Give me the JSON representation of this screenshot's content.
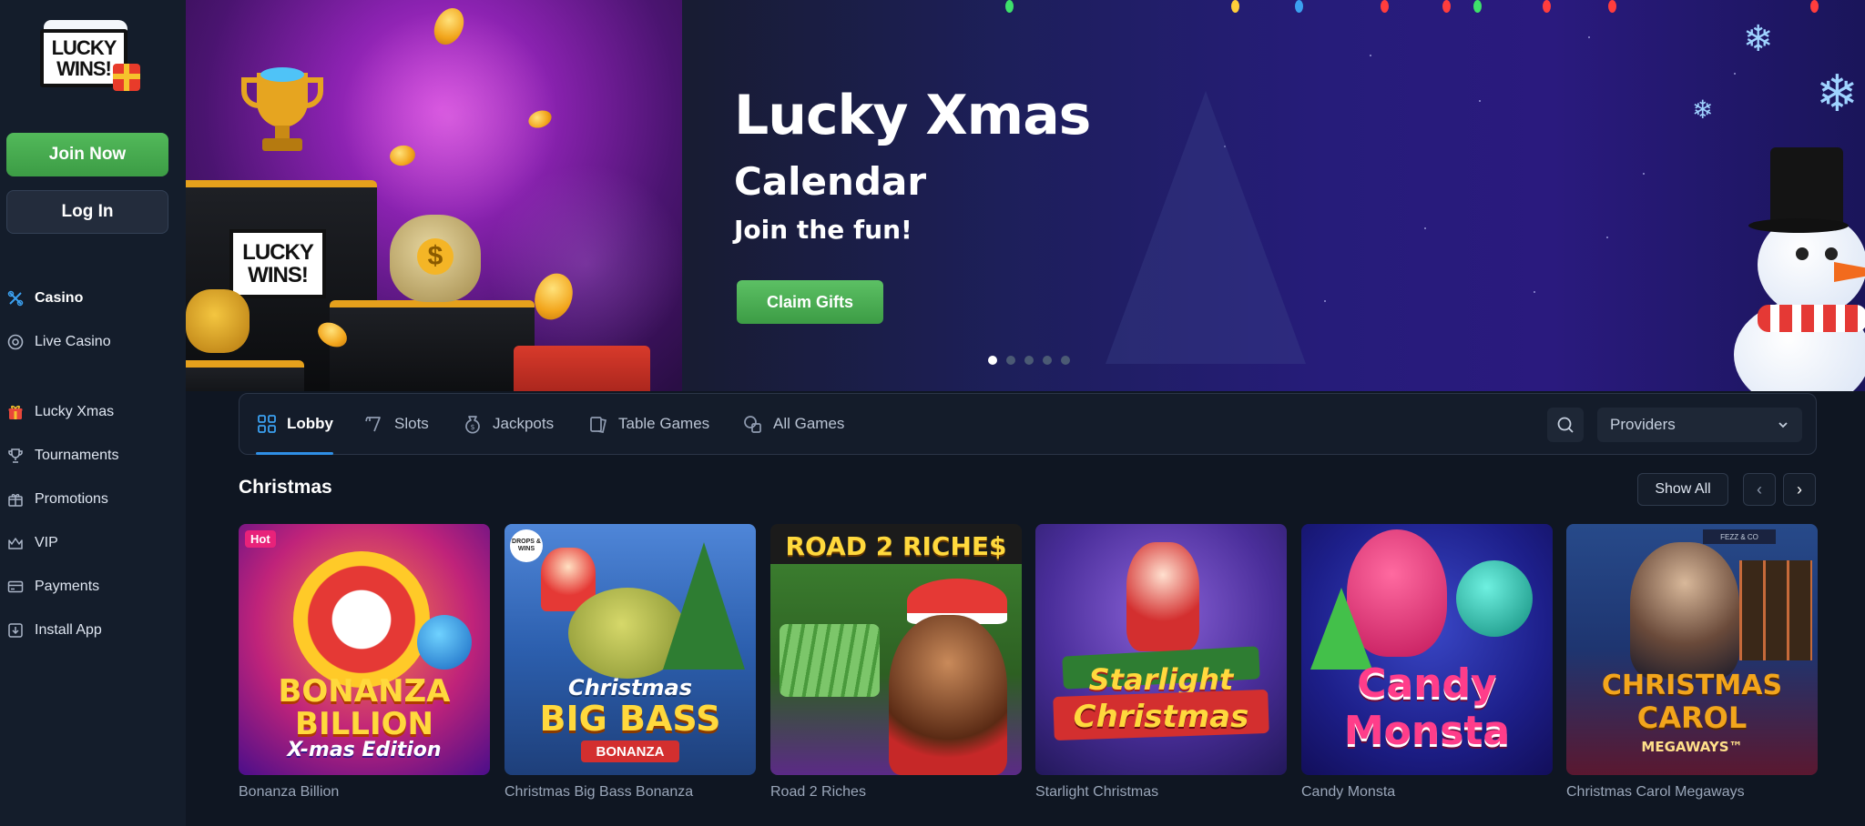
{
  "brand": {
    "logo_line1": "LUCKY",
    "logo_line2": "WINS!"
  },
  "auth": {
    "join_label": "Join Now",
    "login_label": "Log In"
  },
  "sidebar": {
    "items": [
      {
        "label": "Casino",
        "icon": "casino-icon"
      },
      {
        "label": "Live Casino",
        "icon": "live-casino-icon"
      },
      {
        "label": "Lucky Xmas",
        "icon": "gift-icon"
      },
      {
        "label": "Tournaments",
        "icon": "trophy-icon"
      },
      {
        "label": "Promotions",
        "icon": "promotions-icon"
      },
      {
        "label": "VIP",
        "icon": "crown-icon"
      },
      {
        "label": "Payments",
        "icon": "card-icon"
      },
      {
        "label": "Install App",
        "icon": "download-icon"
      }
    ]
  },
  "hero": {
    "title": "Lucky Xmas",
    "subtitle": "Calendar",
    "tagline": "Join the fun!",
    "cta": "Claim Gifts",
    "podium_logo_line1": "LUCKY",
    "podium_logo_line2": "WINS!",
    "slides_total": 5,
    "active_slide": 1
  },
  "tabs": {
    "items": [
      {
        "label": "Lobby",
        "icon": "lobby-icon",
        "active": true
      },
      {
        "label": "Slots",
        "icon": "slots-icon",
        "active": false
      },
      {
        "label": "Jackpots",
        "icon": "jackpots-icon",
        "active": false
      },
      {
        "label": "Table Games",
        "icon": "table-games-icon",
        "active": false
      },
      {
        "label": "All Games",
        "icon": "all-games-icon",
        "active": false
      }
    ],
    "providers_label": "Providers"
  },
  "section": {
    "title": "Christmas",
    "show_all": "Show All",
    "games": [
      {
        "name": "Bonanza Billion",
        "badge": "Hot",
        "art_line1": "BONANZA",
        "art_line2": "BILLION",
        "art_line3": "X-mas Edition"
      },
      {
        "name": "Christmas Big Bass Bonanza",
        "badge_logo": "DROPS & WINS",
        "art_line1": "Christmas",
        "art_line2": "BIG BASS",
        "art_line3": "BONANZA"
      },
      {
        "name": "Road 2 Riches",
        "art_line1": "ROAD 2 RICHE$"
      },
      {
        "name": "Starlight Christmas",
        "art_line1": "Starlight",
        "art_line2": "Christmas"
      },
      {
        "name": "Candy Monsta",
        "art_line1": "Candy",
        "art_line2": "Monsta"
      },
      {
        "name": "Christmas Carol Megaways",
        "art_line1": "CHRISTMAS",
        "art_line2": "CAROL",
        "art_line3": "MEGAWAYS™",
        "art_corner": "FEZZ & CO"
      }
    ]
  },
  "colors": {
    "accent_green": "#4cae52",
    "accent_blue": "#2f8fe6",
    "hot_badge": "#e8227a",
    "bg": "#0f1622",
    "sidebar_bg": "#141d2b"
  }
}
